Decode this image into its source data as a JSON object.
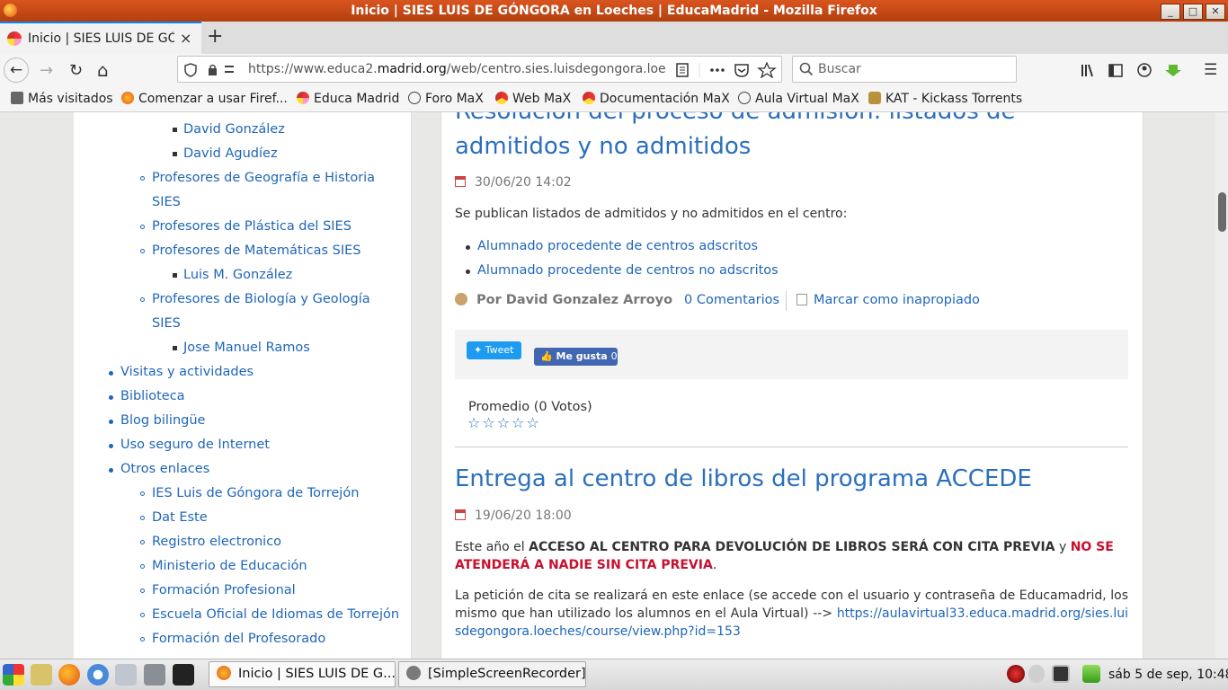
{
  "window": {
    "title": "Inicio | SIES LUIS DE GÓNGORA en Loeches | EducaMadrid - Mozilla Firefox",
    "buttons": [
      "_",
      "□",
      "✕"
    ]
  },
  "tabs": [
    {
      "label": "Inicio | SIES LUIS DE GÓNGORA en Loeches | EducaMadrid",
      "close": "×"
    }
  ],
  "newtab": "+",
  "nav": {
    "back": "←",
    "forward": "→",
    "reload": "↻",
    "home": "⌂",
    "menu": "☰",
    "url_prefix": "https://www.educa2.",
    "url_domain": "madrid.org",
    "url_rest": "/web/centro.sies.luisdegongora.loeches/inicio",
    "dots": "•••",
    "search_placeholder": "Buscar"
  },
  "bookmarks": [
    "Más visitados",
    "Comenzar a usar Firef...",
    "Educa Madrid",
    "Foro MaX",
    "Web MaX",
    "Documentación MaX",
    "Aula Virtual MaX",
    "KAT - Kickass Torrents"
  ],
  "sidebar": {
    "items": [
      {
        "label": "David González",
        "level": 3
      },
      {
        "label": "David Agudíez",
        "level": 3
      },
      {
        "label": "Profesores de Geografía e Historia",
        "level": 2
      },
      {
        "label": "SIES",
        "level": 2,
        "cont": true
      },
      {
        "label": "Profesores de Plástica del SIES",
        "level": 2
      },
      {
        "label": "Profesores de Matemáticas SIES",
        "level": 2
      },
      {
        "label": "Luis M. González",
        "level": 3
      },
      {
        "label": "Profesores de Biología y Geología",
        "level": 2
      },
      {
        "label": "SIES",
        "level": 2,
        "cont": true
      },
      {
        "label": "Jose Manuel Ramos",
        "level": 3
      },
      {
        "label": "Visitas y actividades",
        "level": 1
      },
      {
        "label": "Biblioteca",
        "level": 1
      },
      {
        "label": "Blog bilingüe",
        "level": 1
      },
      {
        "label": "Uso seguro de Internet",
        "level": 1
      },
      {
        "label": "Otros enlaces",
        "level": 1
      },
      {
        "label": "IES Luis de Góngora de Torrejón",
        "level": 2
      },
      {
        "label": "Dat Este",
        "level": 2
      },
      {
        "label": "Registro electronico",
        "level": 2
      },
      {
        "label": "Ministerio de Educación",
        "level": 2
      },
      {
        "label": "Formación Profesional",
        "level": 2
      },
      {
        "label": "Escuela Oficial de Idiomas de Torrejón",
        "level": 2
      },
      {
        "label": "Formación del Profesorado",
        "level": 2
      }
    ]
  },
  "post1": {
    "title_line1": "Resolución del proceso de admisión: listados de",
    "title_line2": "admitidos y no admitidos",
    "date": "30/06/20 14:02",
    "intro": "Se publican listados de admitidos y no admitidos en el centro:",
    "links": [
      "Alumnado procedente de centros adscritos",
      "Alumnado procedente de centros no adscritos"
    ],
    "author": "Por David Gonzalez Arroyo",
    "comments": "0 Comentarios",
    "flag": "Marcar como inapropiado",
    "tweet": "Tweet",
    "like": "Me gusta",
    "like_count": "0",
    "rating_label": "Promedio (0 Votos)",
    "stars": "☆☆☆☆☆"
  },
  "post2": {
    "title": "Entrega al centro de libros del programa ACCEDE",
    "date": "19/06/20 18:00",
    "p1_a": "Este año el ",
    "p1_b": "ACCESO AL CENTRO PARA DEVOLUCIÓN DE LIBROS SERÁ CON CITA PREVIA",
    "p1_c": " y ",
    "p1_d": "NO SE ATENDERÁ A NADIE SIN CITA PREVIA",
    "p1_e": ".",
    "p2_a": "La petición de cita se realizará en este enlace (se accede con el usuario y contraseña de Educamadrid, los mismo que han utilizado los alumnos en el Aula Virtual) --> ",
    "p2_link": "https://aulavirtual33.educa.madrid.org/sies.luisdegongora.loeches/course/view.php?id=153"
  },
  "taskbar": {
    "tasks": [
      "Inicio | SIES LUIS DE G...",
      "[SimpleScreenRecorder]"
    ],
    "clock": "sáb  5 de sep, 10:48"
  },
  "colors": {
    "titlebar": "#c44a16",
    "link": "#1f66b8",
    "heading": "#2a6fbe",
    "alert": "#c8102e"
  }
}
